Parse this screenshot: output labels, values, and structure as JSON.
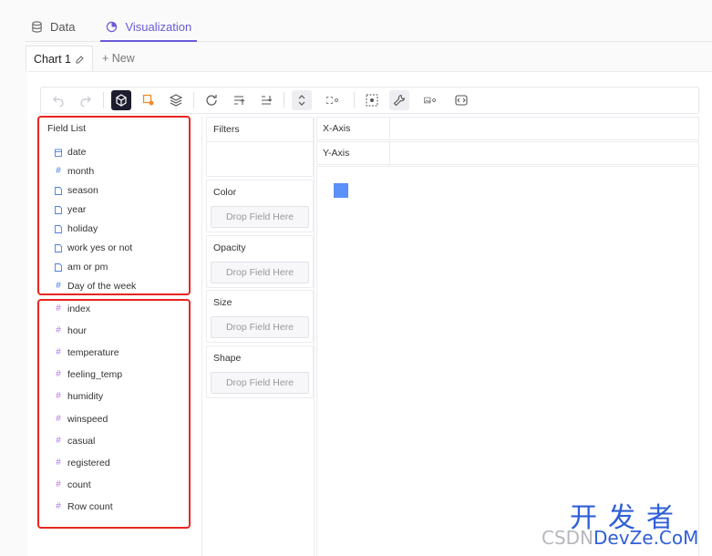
{
  "top_tabs": [
    {
      "label": "Data",
      "icon": "database-icon"
    },
    {
      "label": "Visualization",
      "icon": "chart-icon",
      "active": true
    }
  ],
  "chart_tabs": {
    "current": "Chart 1",
    "new_label": "+ New"
  },
  "toolbar_icons": [
    "undo-icon",
    "redo-icon",
    "cube-icon",
    "mark-type-icon",
    "layers-icon",
    "refresh-icon",
    "sort-ascending-icon",
    "sort-descending-icon",
    "stack-toggle-icon",
    "scale-settings-icon",
    "brush-select-icon",
    "wrench-icon",
    "image-export-icon",
    "code-icon"
  ],
  "field_list": {
    "title": "Field List",
    "dimensions": [
      {
        "name": "date",
        "type": "date"
      },
      {
        "name": "month",
        "type": "number"
      },
      {
        "name": "season",
        "type": "text"
      },
      {
        "name": "year",
        "type": "text"
      },
      {
        "name": "holiday",
        "type": "text"
      },
      {
        "name": "work yes or not",
        "type": "text"
      },
      {
        "name": "am or pm",
        "type": "text"
      },
      {
        "name": "Day of the week",
        "type": "number"
      }
    ],
    "measures": [
      {
        "name": "index"
      },
      {
        "name": "hour"
      },
      {
        "name": "temperature"
      },
      {
        "name": "feeling_temp"
      },
      {
        "name": "humidity"
      },
      {
        "name": "winspeed"
      },
      {
        "name": "casual"
      },
      {
        "name": "registered"
      },
      {
        "name": "count"
      },
      {
        "name": "Row count"
      }
    ]
  },
  "encodings": {
    "filters": "Filters",
    "color": "Color",
    "opacity": "Opacity",
    "size": "Size",
    "shape": "Shape",
    "drop_placeholder": "Drop Field Here"
  },
  "axes": {
    "x": "X-Axis",
    "y": "Y-Axis"
  },
  "watermark": {
    "cn": "开发者",
    "en_prefix": "CSDN",
    "en_brand": "DevZe.CoM"
  },
  "colors": {
    "accent": "#6a5ad6",
    "mark": "#5b8ff9",
    "highlight": "#e8261f",
    "dimension_icon": "#4a7fe0",
    "measure_icon": "#b27ae0"
  }
}
